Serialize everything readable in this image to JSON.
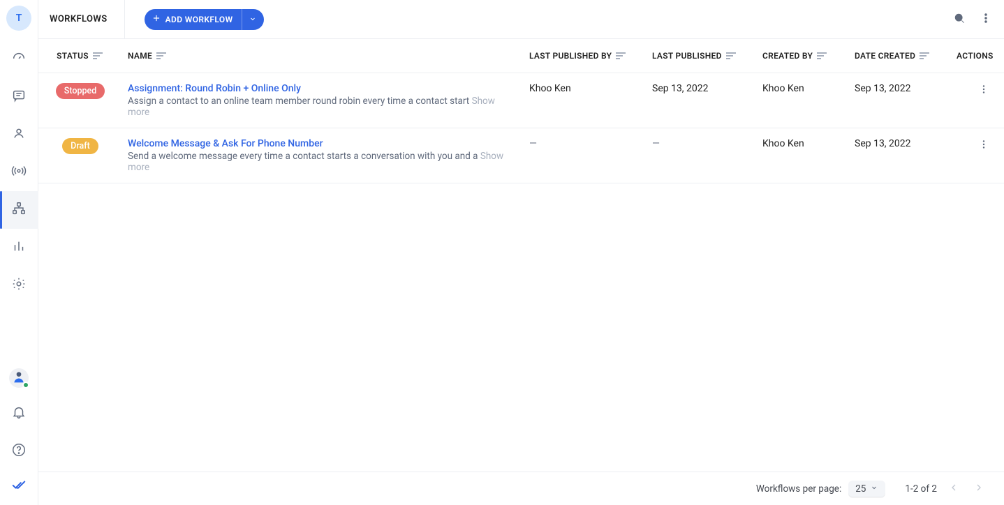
{
  "workspace": {
    "initial": "T"
  },
  "sidebar": {
    "items": [
      "dashboard",
      "inbox",
      "contacts",
      "broadcast",
      "workflows",
      "reports",
      "settings"
    ],
    "active_index": 4
  },
  "header": {
    "title": "WORKFLOWS",
    "add_label": "ADD WORKFLOW"
  },
  "table": {
    "columns": {
      "status": "STATUS",
      "name": "NAME",
      "last_published_by": "LAST PUBLISHED BY",
      "last_published": "LAST PUBLISHED",
      "created_by": "CREATED BY",
      "date_created": "DATE CREATED",
      "actions": "ACTIONS"
    },
    "show_more_label": "Show more",
    "rows": [
      {
        "status_text": "Stopped",
        "status_variant": "stopped",
        "name": "Assignment: Round Robin + Online Only",
        "description": "Assign a contact to an online team member round robin every time a contact start",
        "last_published_by": "Khoo Ken",
        "last_published": "Sep 13, 2022",
        "created_by": "Khoo Ken",
        "date_created": "Sep 13, 2022"
      },
      {
        "status_text": "Draft",
        "status_variant": "draft",
        "name": "Welcome Message & Ask For Phone Number",
        "description": "Send a welcome message every time a contact starts a conversation with you and a",
        "last_published_by": "—",
        "last_published": "—",
        "created_by": "Khoo Ken",
        "date_created": "Sep 13, 2022"
      }
    ]
  },
  "footer": {
    "per_page_label": "Workflows per page:",
    "per_page_value": "25",
    "range_text": "1-2 of 2"
  }
}
